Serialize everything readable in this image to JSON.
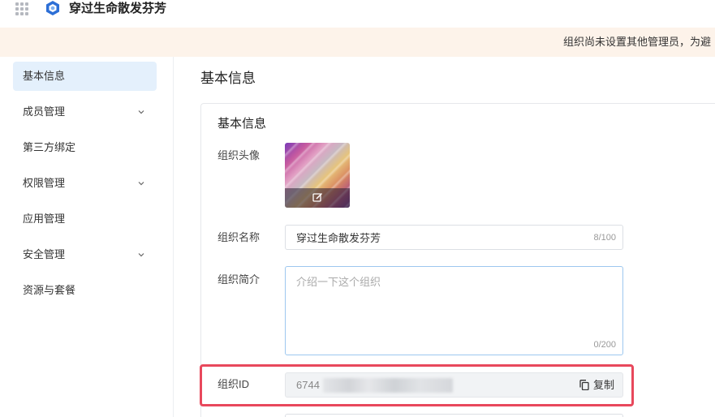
{
  "header": {
    "apps_icon": "grid-apps-icon",
    "logo_icon": "hexagon-logo-icon",
    "org_name": "穿过生命散发芬芳"
  },
  "banner": {
    "text": "组织尚未设置其他管理员，为避"
  },
  "sidebar": {
    "items": [
      {
        "label": "基本信息",
        "active": true,
        "expandable": false
      },
      {
        "label": "成员管理",
        "active": false,
        "expandable": true
      },
      {
        "label": "第三方绑定",
        "active": false,
        "expandable": false
      },
      {
        "label": "权限管理",
        "active": false,
        "expandable": true
      },
      {
        "label": "应用管理",
        "active": false,
        "expandable": false
      },
      {
        "label": "安全管理",
        "active": false,
        "expandable": true
      },
      {
        "label": "资源与套餐",
        "active": false,
        "expandable": false
      }
    ]
  },
  "main": {
    "page_title": "基本信息",
    "card_title": "基本信息",
    "avatar_label": "组织头像",
    "avatar_edit_icon": "edit-icon",
    "name_label": "组织名称",
    "name_value": "穿过生命散发芬芳",
    "name_counter": "8/100",
    "intro_label": "组织简介",
    "intro_placeholder": "介绍一下这个组织",
    "intro_counter": "0/200",
    "id_label": "组织ID",
    "id_value_visible": "6744",
    "copy_label": "复制",
    "copy_icon": "copy-icon"
  },
  "colors": {
    "accent": "#e4f0fc",
    "banner_bg": "#fdf3ea",
    "highlight": "#e8485c"
  }
}
